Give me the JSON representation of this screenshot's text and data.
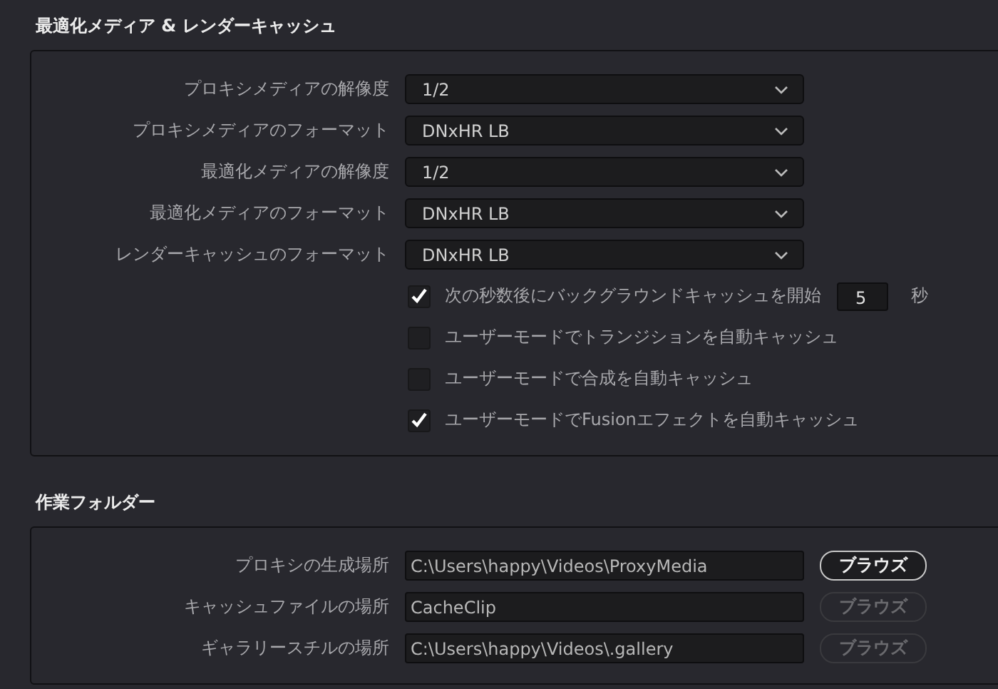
{
  "sections": [
    {
      "title": "最適化メディア & レンダーキャッシュ",
      "dropdowns": [
        {
          "label": "プロキシメディアの解像度",
          "value": "1/2"
        },
        {
          "label": "プロキシメディアのフォーマット",
          "value": "DNxHR LB"
        },
        {
          "label": "最適化メディアの解像度",
          "value": "1/2"
        },
        {
          "label": "最適化メディアのフォーマット",
          "value": "DNxHR LB"
        },
        {
          "label": "レンダーキャッシュのフォーマット",
          "value": "DNxHR LB"
        }
      ],
      "checkboxes": [
        {
          "label": "次の秒数後にバックグラウンドキャッシュを開始",
          "checked": true,
          "value": "5",
          "unit": "秒"
        },
        {
          "label": "ユーザーモードでトランジションを自動キャッシュ",
          "checked": false
        },
        {
          "label": "ユーザーモードで合成を自動キャッシュ",
          "checked": false
        },
        {
          "label": "ユーザーモードでFusionエフェクトを自動キャッシュ",
          "checked": true
        }
      ]
    },
    {
      "title": "作業フォルダー",
      "folders": [
        {
          "label": "プロキシの生成場所",
          "value": "C:\\Users\\happy\\Videos\\ProxyMedia",
          "button": "ブラウズ",
          "disabled": false
        },
        {
          "label": "キャッシュファイルの場所",
          "value": "CacheClip",
          "button": "ブラウズ",
          "disabled": true
        },
        {
          "label": "ギャラリースチルの場所",
          "value": "C:\\Users\\happy\\Videos\\.gallery",
          "button": "ブラウズ",
          "disabled": true
        }
      ]
    }
  ]
}
